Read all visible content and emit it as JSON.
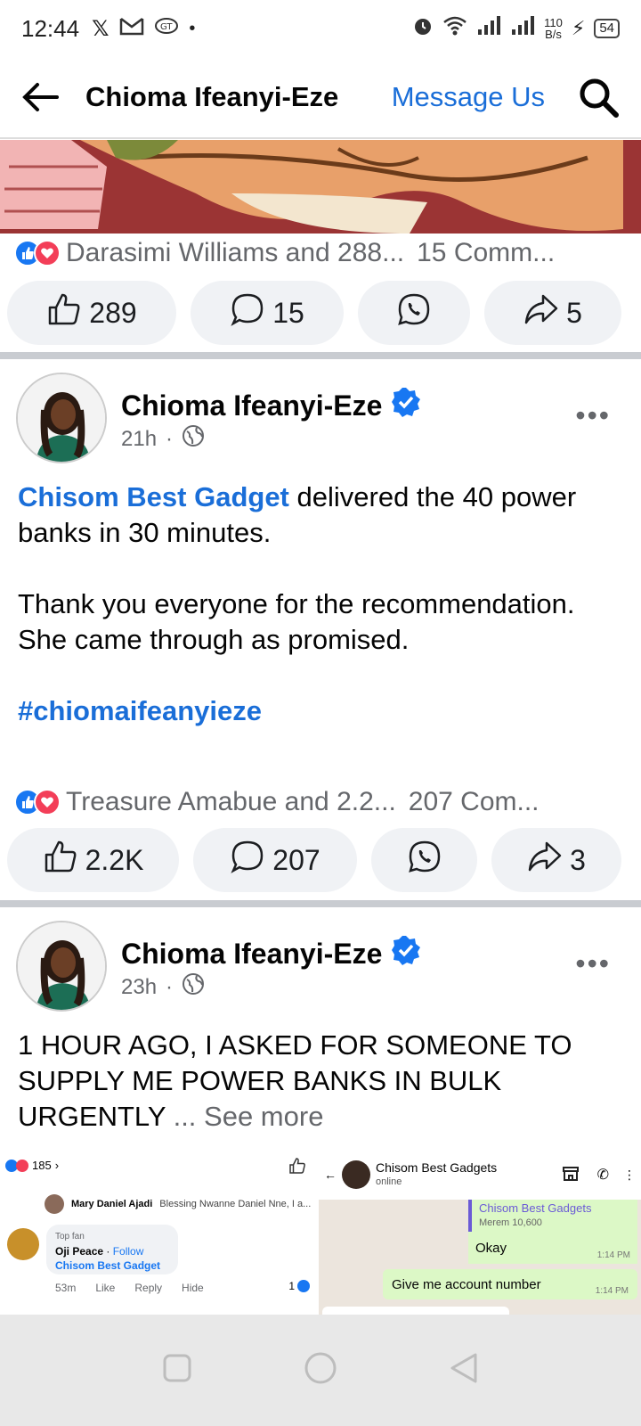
{
  "status_bar": {
    "time": "12:44",
    "net_speed_value": "110",
    "net_speed_unit": "B/s",
    "battery": "54"
  },
  "header": {
    "title": "Chioma Ifeanyi-Eze",
    "message_us": "Message Us"
  },
  "post1": {
    "reactions_text": "Darasimi Williams and 288...",
    "comments_text": "15 Comm...",
    "like_count": "289",
    "comment_count": "15",
    "share_count": "5"
  },
  "post2": {
    "author": "Chioma Ifeanyi-Eze",
    "time": "21h",
    "mention": "Chisom Best Gadget",
    "text_line1": " delivered the 40 power banks in 30 minutes.",
    "text_para2": "Thank you everyone for the recommendation.",
    "text_para3": "She came through as promised.",
    "hashtag": "#chiomaifeanyieze",
    "reactions_text": "Treasure Amabue and 2.2...",
    "comments_text": "207 Com...",
    "like_count": "2.2K",
    "comment_count": "207",
    "share_count": "3"
  },
  "post3": {
    "author": "Chioma Ifeanyi-Eze",
    "time": "23h",
    "text": "1 HOUR AGO, I ASKED FOR SOMEONE TO SUPPLY ME POWER BANKS IN BULK URGENTLY",
    "see_more": "... See more",
    "collage_left": {
      "reaction_count": "185",
      "commenter1_name": "Mary Daniel Ajadi",
      "commenter1_text": "Blessing Nwanne Daniel Nne, I a...",
      "badge": "Top fan",
      "commenter2_name": "Oji Peace",
      "follow": "Follow",
      "commenter2_text": "Chisom Best Gadget",
      "time": "53m",
      "like": "Like",
      "reply": "Reply",
      "hide": "Hide",
      "like_count": "1"
    },
    "collage_right": {
      "chat_name": "Chisom Best Gadgets",
      "chat_status": "online",
      "quoted_name": "Chisom Best Gadgets",
      "quoted_text": "Merem 10,600",
      "msg1": "Okay",
      "msg1_time": "1:14 PM",
      "msg2": "Give me account number",
      "msg2_time": "1:14 PM"
    }
  },
  "colors": {
    "link": "#1a6ed8",
    "like": "#1877f2",
    "love": "#f33e58",
    "verified": "#1877f2"
  }
}
